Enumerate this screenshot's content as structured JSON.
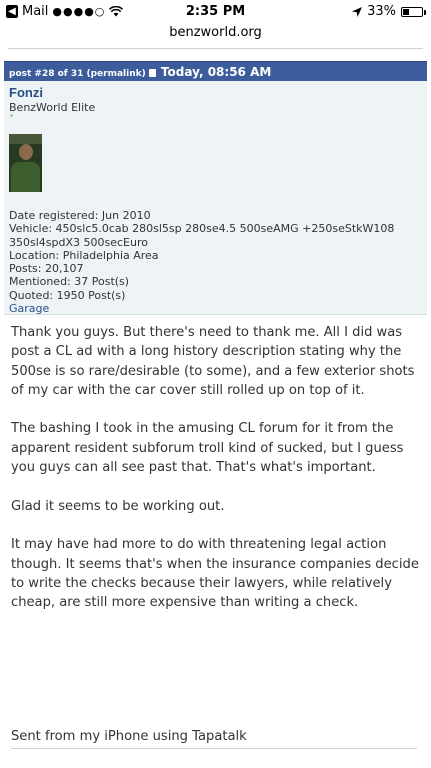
{
  "status_bar": {
    "back_icon": "back-arrow-icon",
    "carrier": "Mail",
    "signal": "●●●●○",
    "wifi_icon": "wifi-icon",
    "time": "2:35 PM",
    "location_icon": "location-arrow-icon",
    "battery_percent": "33%",
    "battery_level": 0.33
  },
  "browser": {
    "url": "benzworld.org"
  },
  "post": {
    "number_label": "post #28 of 31 (permalink)",
    "timestamp": "Today, 08:56 AM",
    "header_color": "#3d5c9b"
  },
  "user": {
    "name": "Fonzi",
    "title": "BenzWorld Elite",
    "reputation": "*",
    "avatar_icon": "user-avatar",
    "details": [
      "Date registered: Jun 2010",
      "Vehicle: 450slc5.0cab 280sl5sp 280se4.5 500seAMG +250seStkW108",
      "350sl4spdX3 500secEuro",
      "Location: Philadelphia Area",
      "Posts: 20,107",
      "Mentioned: 37 Post(s)",
      "Quoted: 1950 Post(s)"
    ],
    "garage_link": "Garage"
  },
  "message": {
    "paragraphs": [
      "Thank you guys. But there's need to thank me. All I did was post a CL ad with a long history description stating why the 500se is so rare/desirable (to some), and a few exterior shots of my car with the car cover still rolled up on top of it.",
      "The bashing I took in the amusing CL forum for it from the apparent resident subforum troll kind of sucked, but I guess you guys can all see past that. That's what's important.",
      "Glad it seems to be working out.",
      "It may have had more to do with threatening legal action though. It seems that's when the insurance companies decide to write the checks because their lawyers, while relatively cheap, are still more expensive than writing a check."
    ],
    "signature": "Sent from my iPhone using Tapatalk"
  }
}
